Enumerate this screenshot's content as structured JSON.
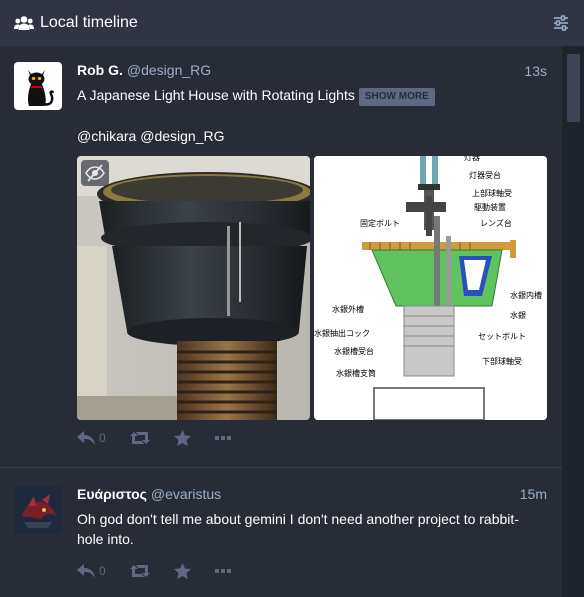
{
  "header": {
    "title": "Local timeline",
    "icon": "users-icon",
    "settings_icon": "sliders-icon"
  },
  "statuses": [
    {
      "display_name": "Rob G.",
      "acct": "@design_RG",
      "time": "13s",
      "text": "A Japanese Light House with Rotating Lights",
      "show_more": "SHOW MORE",
      "mentions": "@chikara @design_RG",
      "reply_count": "0",
      "media": [
        {
          "alt": "Photo of a lighthouse lens mechanism"
        },
        {
          "alt": "Diagram of lighthouse rotation mechanism",
          "labels": [
            "灯器",
            "灯器受台",
            "上部球軸受",
            "駆動装置",
            "固定ボルト",
            "レンズ台",
            "水銀外槽",
            "水銀内槽",
            "水銀抽出コック",
            "水銀",
            "水銀槽受台",
            "セットボルト",
            "下部球軸受",
            "水銀槽支筒"
          ]
        }
      ]
    },
    {
      "display_name": "Ευάριστος",
      "acct": "@evaristus",
      "time": "15m",
      "text": "Oh god don't tell me about gemini I don't need another project to rabbit-hole into.",
      "reply_count": "0"
    }
  ],
  "colors": {
    "background": "#282c37",
    "header": "#313543",
    "secondary_text": "#9baec8",
    "action_icon": "#606984"
  }
}
